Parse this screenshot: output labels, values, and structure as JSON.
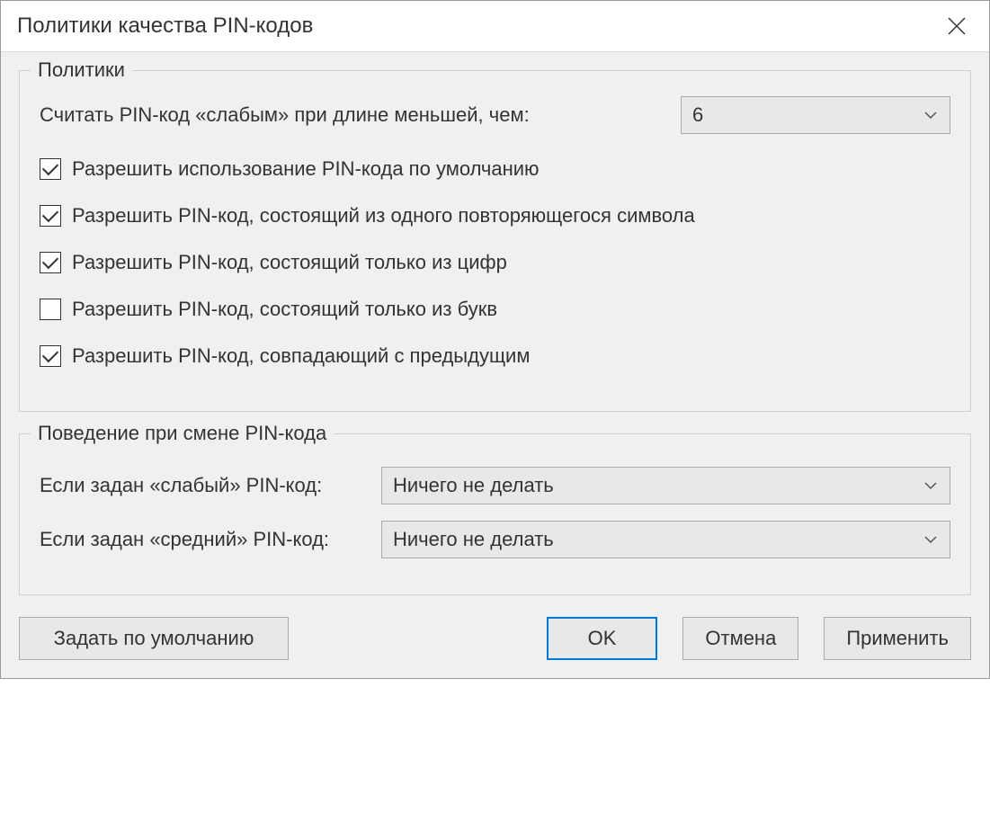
{
  "title": "Политики качества PIN-кодов",
  "policies": {
    "legend": "Политики",
    "weak_label": "Считать PIN-код «слабым» при длине меньшей, чем:",
    "weak_value": "6",
    "checkboxes": [
      {
        "checked": true,
        "label": "Разрешить использование PIN-кода по умолчанию"
      },
      {
        "checked": true,
        "label": "Разрешить PIN-код, состоящий из одного повторяющегося символа"
      },
      {
        "checked": true,
        "label": "Разрешить PIN-код, состоящий только из цифр"
      },
      {
        "checked": false,
        "label": "Разрешить PIN-код, состоящий только из букв"
      },
      {
        "checked": true,
        "label": "Разрешить PIN-код, совпадающий с предыдущим"
      }
    ]
  },
  "behavior": {
    "legend": "Поведение при смене PIN-кода",
    "weak_label": "Если задан «слабый» PIN-код:",
    "weak_value": "Ничего не делать",
    "medium_label": "Если задан «средний» PIN-код:",
    "medium_value": "Ничего не делать"
  },
  "buttons": {
    "default": "Задать по умолчанию",
    "ok": "OK",
    "cancel": "Отмена",
    "apply": "Применить"
  }
}
